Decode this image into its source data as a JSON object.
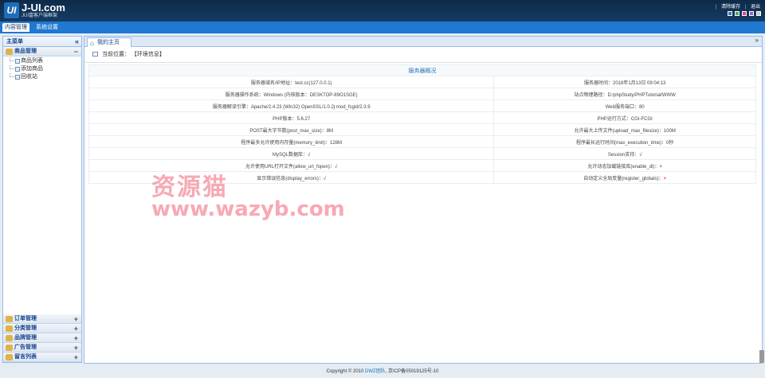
{
  "header": {
    "logo_mark": "UI",
    "logo_name": "J-UI.com",
    "logo_sub": "JUI富客户端框架",
    "links": [
      "清除缓存",
      "退出"
    ],
    "theme_colors": [
      "#2a7bd0",
      "#51a85a",
      "#e03ea0",
      "#9063c9",
      "#c8c8c8"
    ]
  },
  "nav": [
    "内容管理",
    "系统设置"
  ],
  "sidebar": {
    "title": "主菜单",
    "open_group": {
      "label": "商品管理",
      "items": [
        "商品列表",
        "添加商品",
        "回收站"
      ]
    },
    "groups": [
      "订单管理",
      "分类管理",
      "品牌管理",
      "广告管理",
      "留言列表"
    ]
  },
  "main": {
    "tab": "我的主页",
    "breadcrumb_prefix": "当前位置：",
    "breadcrumb_value": "【环境信息】",
    "caption": "服务器概况",
    "rows": [
      [
        "服务器域名/IP地址：test.cc(127.0.0.1)",
        "服务器时间：2018年1月13日 09:04:13"
      ],
      [
        "服务器操作系统：Windows (内核版本：DESKTOP-89O1SGE)",
        "站点物理路径：D:/phpStudy/PHPTutorial/WWW"
      ],
      [
        "服务器解译引擎：Apache/2.4.23 (Win32) OpenSSL/1.0.2j mod_fcgid/2.3.9",
        "Web服务端口：80"
      ],
      [
        "PHP版本：5.6.27",
        "PHP运行方式：CGI-FCGI"
      ],
      [
        "POST最大字节数(post_max_size)：8M",
        "允许最大上传文件(upload_max_filesize)：100M"
      ],
      [
        "程序最多允许使用内存量(memory_limit)：128M",
        "程序最长运行时间(max_execution_time)：0秒"
      ],
      [
        "MySQL数据库：√",
        "Session支持：√"
      ],
      [
        "允许使用URL打开文件(allow_url_fopen)：√",
        "允许动态加载链接库(enable_dl)："
      ],
      [
        "显示错误信息(display_errors)：√",
        "自动定义全局变量(register_globals)："
      ]
    ],
    "cross": "×"
  },
  "watermark": {
    "cn": "资源猫",
    "url": "www.wazyb.com"
  },
  "footer": {
    "prefix": "Copyright © 2010",
    "link": "DWZ团队",
    "suffix": ", 京ICP备05019125号-10"
  }
}
